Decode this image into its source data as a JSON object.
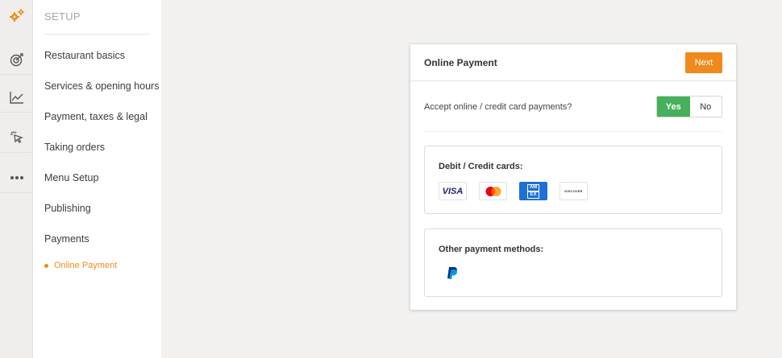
{
  "rail": {
    "icons": [
      "gears-icon",
      "target-icon",
      "chart-icon",
      "cursor-click-icon",
      "more-icon"
    ]
  },
  "sidebar": {
    "title": "SETUP",
    "items": [
      {
        "label": "Restaurant basics"
      },
      {
        "label": "Services & opening hours"
      },
      {
        "label": "Payment, taxes & legal"
      },
      {
        "label": "Taking orders"
      },
      {
        "label": "Menu Setup"
      },
      {
        "label": "Publishing"
      },
      {
        "label": "Payments"
      }
    ],
    "sub_item": {
      "label": "Online Payment"
    }
  },
  "panel": {
    "title": "Online Payment",
    "next_label": "Next",
    "question": "Accept online / credit card payments?",
    "yes_label": "Yes",
    "no_label": "No",
    "selected": "Yes",
    "cards": {
      "title": "Debit / Credit cards:",
      "visa_text": "VISA",
      "amex_top": "AM",
      "amex_bottom": "EX",
      "discover_text": "DISCOVER"
    },
    "other": {
      "title": "Other payment methods:"
    }
  },
  "colors": {
    "accent": "#f08a1d",
    "yes_green": "#46b05b",
    "visa_blue": "#1a1f71",
    "amex_blue": "#1e6fd9",
    "paypal_dark": "#003087",
    "paypal_light": "#009cde",
    "mastercard_red": "#eb001b",
    "mastercard_orange": "#f79e1b"
  }
}
